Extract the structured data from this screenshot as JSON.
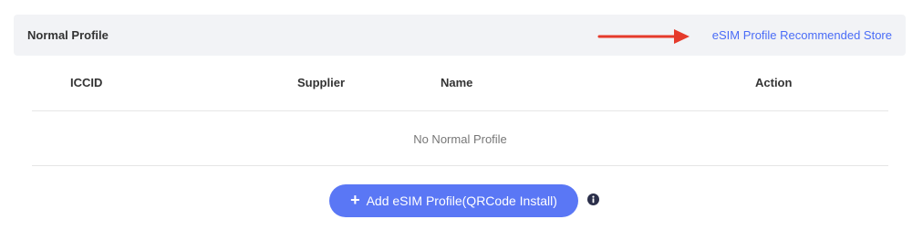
{
  "header": {
    "title": "Normal Profile",
    "store_link": "eSIM Profile Recommended Store"
  },
  "table": {
    "columns": [
      "ICCID",
      "Supplier",
      "Name",
      "Action"
    ],
    "empty_message": "No Normal Profile"
  },
  "actions": {
    "add_button_label": "Add eSIM Profile(QRCode Install)",
    "add_button_icon": "plus-icon",
    "info_icon": "info-icon"
  },
  "colors": {
    "accent": "#5a77f5",
    "link": "#4a6cf7",
    "arrow": "#e53a2b",
    "header_bg": "#f2f3f6"
  }
}
